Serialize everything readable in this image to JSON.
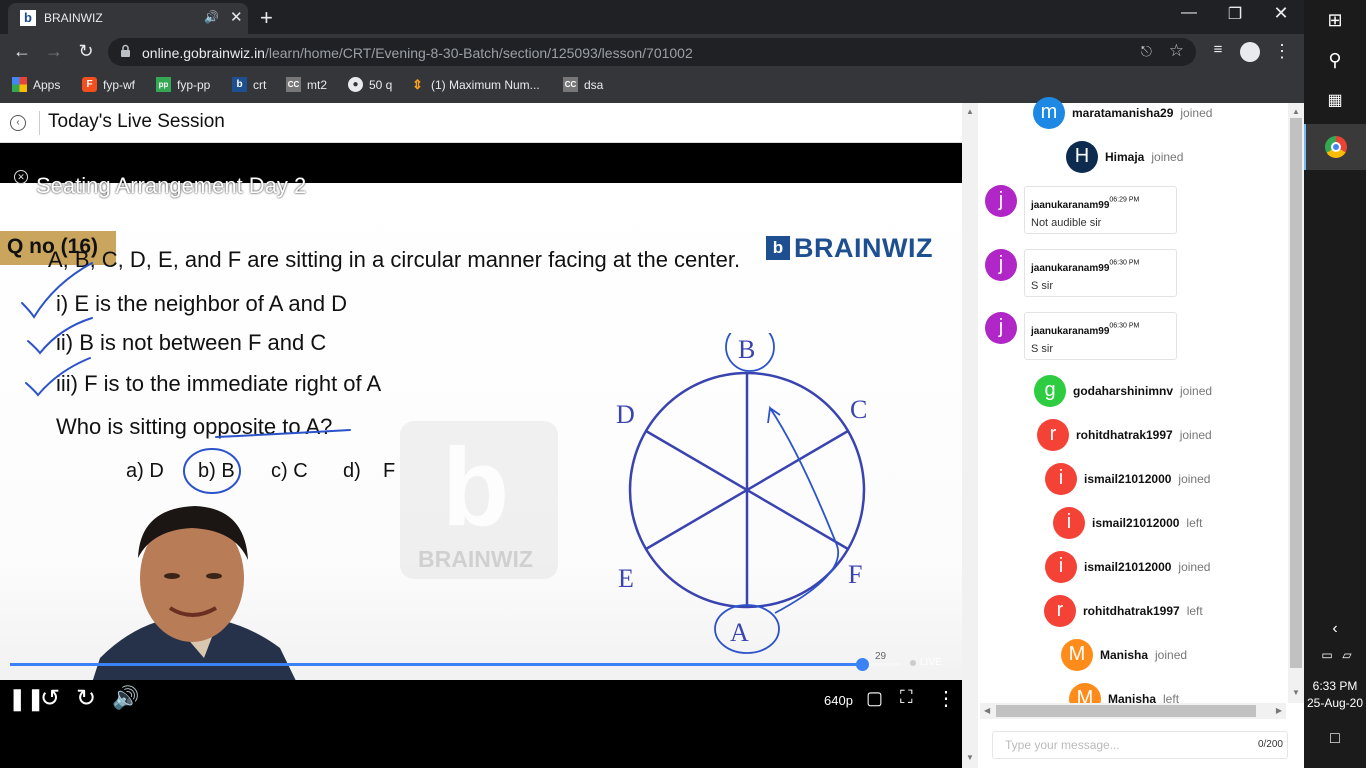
{
  "browser": {
    "tab_title": "BRAINWIZ",
    "tab_favicon_letter": "b",
    "url_domain": "online.gobrainwiz.in",
    "url_path": "/learn/home/CRT/Evening-8-30-Batch/section/125093/lesson/701002"
  },
  "bookmarks": [
    {
      "label": "Apps",
      "icon": "apps-grid-icon",
      "color": "#ea4335"
    },
    {
      "label": "fyp-wf",
      "icon": "figma-icon",
      "color": "#f24e1e"
    },
    {
      "label": "fyp-pp",
      "icon": "image-icon",
      "color": "#34a853"
    },
    {
      "label": "crt",
      "icon": "brainwiz-icon",
      "color": "#1d4f91"
    },
    {
      "label": "mt2",
      "icon": "cc-icon",
      "color": "#777777"
    },
    {
      "label": "50 q",
      "icon": "globe-icon",
      "color": "#e8eaed"
    },
    {
      "label": "(1) Maximum Num...",
      "icon": "leetcode-icon",
      "color": "#f89f1b"
    },
    {
      "label": "dsa",
      "icon": "cc-icon",
      "color": "#777777"
    }
  ],
  "session": {
    "title": "Today's Live Session"
  },
  "video": {
    "title": "Seating Arrangement  Day 2",
    "qno": "Q no (16)",
    "brand": "BRAINWIZ",
    "question": "A, B, C, D, E, and F are sitting in a circular manner facing at the center.",
    "statements": [
      "i)  E is the neighbor of A and D",
      "ii) B is not between F and C",
      "iii) F is to the immediate right of A"
    ],
    "prompt": "Who is sitting opposite to A?",
    "options": [
      "a) D",
      "b) B",
      "c) C",
      "d)",
      "F"
    ],
    "watermark": "BRAINWIZ",
    "diagram_labels": {
      "top": "B",
      "top_right": "C",
      "right_bottom": "F",
      "bottom": "A",
      "left_bottom": "E",
      "left_top": "D"
    },
    "progress": 0.957,
    "time_tip": "29",
    "live_label": "LIVE",
    "quality": "640p"
  },
  "chat": {
    "entries": [
      {
        "type": "event",
        "initial": "m",
        "color": "#1e88e5",
        "user": "maratamanisha29",
        "action": "joined"
      },
      {
        "type": "event",
        "initial": "H",
        "color": "#0d2b4e",
        "user": "Himaja",
        "action": "joined"
      },
      {
        "type": "message",
        "initial": "j",
        "color": "#b026c7",
        "user": "jaanukaranam99",
        "time": "06:29 PM",
        "text": "Not audible sir"
      },
      {
        "type": "message",
        "initial": "j",
        "color": "#b026c7",
        "user": "jaanukaranam99",
        "time": "06:30 PM",
        "text": "S sir"
      },
      {
        "type": "message",
        "initial": "j",
        "color": "#b026c7",
        "user": "jaanukaranam99",
        "time": "06:30 PM",
        "text": "S sir"
      },
      {
        "type": "event",
        "initial": "g",
        "color": "#2ecc40",
        "user": "godaharshinimnv",
        "action": "joined"
      },
      {
        "type": "event",
        "initial": "r",
        "color": "#f44336",
        "user": "rohitdhatrak1997",
        "action": "joined"
      },
      {
        "type": "event",
        "initial": "i",
        "color": "#f44336",
        "user": "ismail21012000",
        "action": "joined"
      },
      {
        "type": "event",
        "initial": "i",
        "color": "#f44336",
        "user": "ismail21012000",
        "action": "left"
      },
      {
        "type": "event",
        "initial": "i",
        "color": "#f44336",
        "user": "ismail21012000",
        "action": "joined"
      },
      {
        "type": "event",
        "initial": "r",
        "color": "#f44336",
        "user": "rohitdhatrak1997",
        "action": "left"
      },
      {
        "type": "event",
        "initial": "M",
        "color": "#ff8c1a",
        "user": "Manisha",
        "action": "joined"
      },
      {
        "type": "event",
        "initial": "M",
        "color": "#ff8c1a",
        "user": "Manisha",
        "action": "left"
      }
    ],
    "input_placeholder": "Type your message...",
    "char_count": "0/200"
  },
  "taskbar": {
    "time": "6:33 PM",
    "date": "25-Aug-20"
  }
}
